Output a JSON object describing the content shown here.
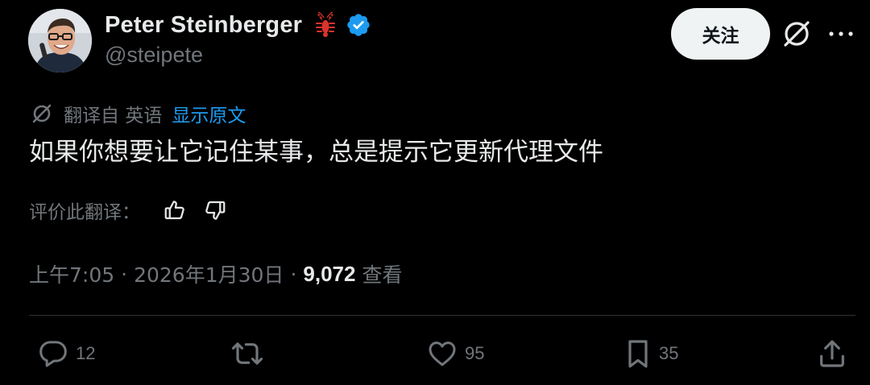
{
  "author": {
    "display_name": "Peter Steinberger",
    "handle": "@steipete",
    "emoji_icon": "lobster-icon",
    "verified_icon": "verified-badge-icon",
    "verified_color": "#1d9bf0"
  },
  "header": {
    "follow_label": "关注",
    "grok_icon": "grok-icon",
    "more_icon": "more-icon"
  },
  "translation": {
    "icon": "translate-icon",
    "translated_from": "翻译自 英语",
    "show_original": "显示原文",
    "link_color": "#1d9bf0"
  },
  "post": {
    "text": "如果你想要让它记住某事，总是提示它更新代理文件"
  },
  "rating": {
    "label": "评价此翻译：",
    "up_icon": "thumbs-up-icon",
    "down_icon": "thumbs-down-icon"
  },
  "meta": {
    "time": "上午7:05",
    "separator": "·",
    "date": "2026年1月30日",
    "views_count": "9,072",
    "views_label": "查看"
  },
  "actions": {
    "reply": {
      "icon": "reply-icon",
      "count": "12"
    },
    "repost": {
      "icon": "repost-icon",
      "count": ""
    },
    "like": {
      "icon": "heart-icon",
      "count": "95"
    },
    "bookmark": {
      "icon": "bookmark-icon",
      "count": "35"
    },
    "share": {
      "icon": "share-icon",
      "count": ""
    }
  }
}
